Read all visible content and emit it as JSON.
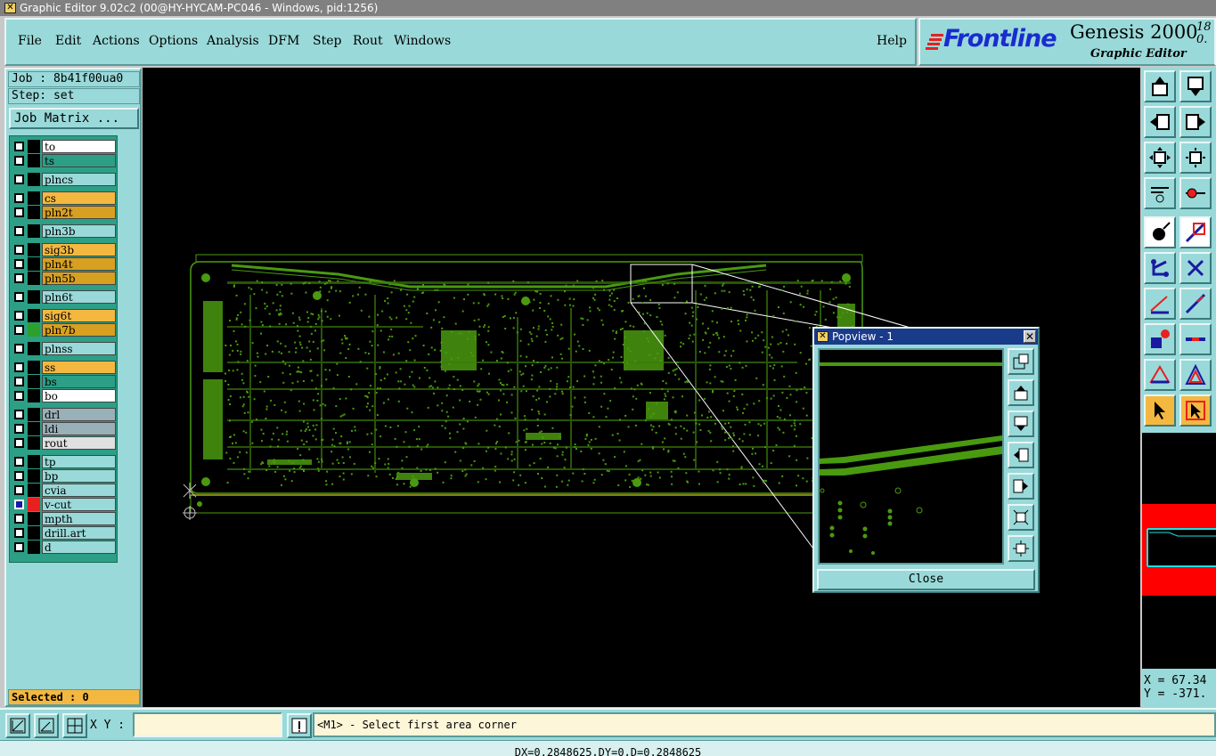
{
  "window": {
    "title": "Graphic Editor 9.02c2 (00@HY-HYCAM-PC046 - Windows, pid:1256)"
  },
  "menu": {
    "items": [
      "File",
      "Edit",
      "Actions",
      "Options",
      "Analysis",
      "DFM",
      "Step",
      "Rout",
      "Windows"
    ],
    "help": "Help"
  },
  "logo": {
    "brand": "Frontline",
    "product": "Genesis 2000",
    "version_top": "18",
    "version_bottom": "0.",
    "subtitle": "Graphic Editor"
  },
  "job": {
    "job_line": "Job : 8b41f00ua0",
    "step_line": "Step: set",
    "matrix_button": "Job Matrix ..."
  },
  "layers": [
    {
      "name": "to",
      "color": "#ffffff",
      "mark": "#000000"
    },
    {
      "name": "ts",
      "color": "#2c9f86",
      "mark": "#000000"
    },
    {
      "name": "plncs",
      "color": "#9ad9d9",
      "mark": "#000000"
    },
    {
      "name": "cs",
      "color": "#f4b840",
      "mark": "#000000"
    },
    {
      "name": "pln2t",
      "color": "#d8a020",
      "mark": "#000000"
    },
    {
      "name": "pln3b",
      "color": "#9ad9d9",
      "mark": "#000000"
    },
    {
      "name": "sig3b",
      "color": "#f4b840",
      "mark": "#000000"
    },
    {
      "name": "pln4t",
      "color": "#d8a020",
      "mark": "#000000"
    },
    {
      "name": "pln5b",
      "color": "#d8a020",
      "mark": "#000000"
    },
    {
      "name": "pln6t",
      "color": "#9ad9d9",
      "mark": "#000000"
    },
    {
      "name": "sig6t",
      "color": "#f4b840",
      "mark": "#000000"
    },
    {
      "name": "pln7b",
      "color": "#d8a020",
      "mark": "#2ca02c"
    },
    {
      "name": "plnss",
      "color": "#9ad9d9",
      "mark": "#000000"
    },
    {
      "name": "ss",
      "color": "#f4b840",
      "mark": "#000000"
    },
    {
      "name": "bs",
      "color": "#2c9f86",
      "mark": "#000000"
    },
    {
      "name": "bo",
      "color": "#ffffff",
      "mark": "#000000"
    },
    {
      "name": "drl",
      "color": "#9ab0b8",
      "mark": "#000000"
    },
    {
      "name": "ldi",
      "color": "#9ab0b8",
      "mark": "#000000"
    },
    {
      "name": "rout",
      "color": "#e0e0e0",
      "mark": "#000000"
    },
    {
      "name": "tp",
      "color": "#9ad9d9",
      "mark": "#000000"
    },
    {
      "name": "bp",
      "color": "#9ad9d9",
      "mark": "#000000"
    },
    {
      "name": "cvia",
      "color": "#9ad9d9",
      "mark": "#000000"
    },
    {
      "name": "v-cut",
      "color": "#9ad9d9",
      "mark": "#e82020",
      "active": true
    },
    {
      "name": "mpth",
      "color": "#9ad9d9",
      "mark": "#000000"
    },
    {
      "name": "drill.art",
      "color": "#9ad9d9",
      "mark": "#000000"
    },
    {
      "name": "d",
      "color": "#9ad9d9",
      "mark": "#000000"
    }
  ],
  "selected": "Selected : 0",
  "popview": {
    "title": "Popview - 1",
    "close_label": "Close"
  },
  "coords": {
    "x": "X = 67.34",
    "y": "Y = -371."
  },
  "bottom": {
    "xy_label": "X Y :",
    "xy_value": "",
    "prompt": "<M1> - Select first area corner"
  },
  "status": "DX=0.2848625,DY=0,D=0.2848625",
  "colors": {
    "panel": "#9ad9d9",
    "board": "#4a9a10",
    "accent": "#f4b840",
    "title_active": "#1a3a8a"
  }
}
